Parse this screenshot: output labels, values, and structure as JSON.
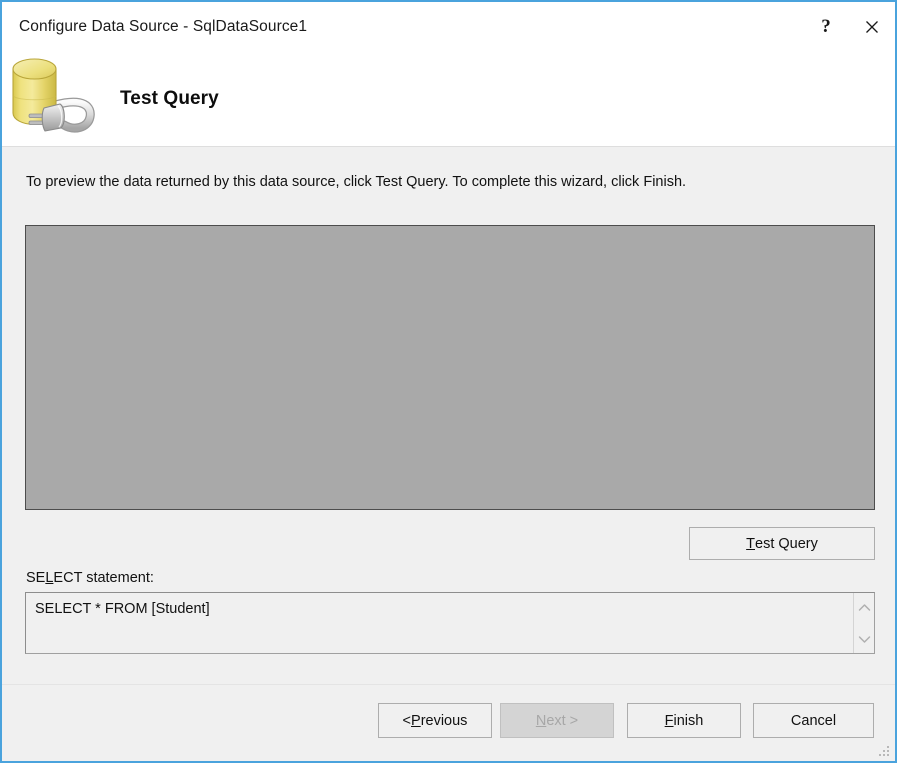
{
  "window": {
    "title": "Configure Data Source - SqlDataSource1",
    "help_icon": "question-mark-icon",
    "close_icon": "close-icon",
    "border_color": "#4aa3dd"
  },
  "header": {
    "icon": "database-plug-icon",
    "title": "Test Query"
  },
  "body": {
    "instruction": "To preview the data returned by this data source, click Test Query. To complete this wizard, click Finish.",
    "results_panel": {
      "name": "query-results-grid",
      "content": "",
      "background_color": "#a9a9a9"
    },
    "test_query_button": {
      "accel": "T",
      "rest": "est Query"
    },
    "select_label": {
      "pre": "SE",
      "accel": "L",
      "post": "ECT statement:"
    },
    "sql_statement": "SELECT * FROM [Student]",
    "scrollbar": {
      "up_icon": "chevron-up-icon",
      "down_icon": "chevron-down-icon"
    }
  },
  "footer": {
    "buttons": [
      {
        "name": "previous-button",
        "pre": "< ",
        "accel": "P",
        "post": "revious",
        "disabled": false
      },
      {
        "name": "next-button",
        "pre": "",
        "accel": "N",
        "post": "ext >",
        "disabled": true
      },
      {
        "name": "finish-button",
        "pre": "",
        "accel": "F",
        "post": "inish",
        "disabled": false
      },
      {
        "name": "cancel-button",
        "pre": "Cancel",
        "accel": "",
        "post": "",
        "disabled": false
      }
    ],
    "resize_grip": "resize-grip-icon"
  }
}
